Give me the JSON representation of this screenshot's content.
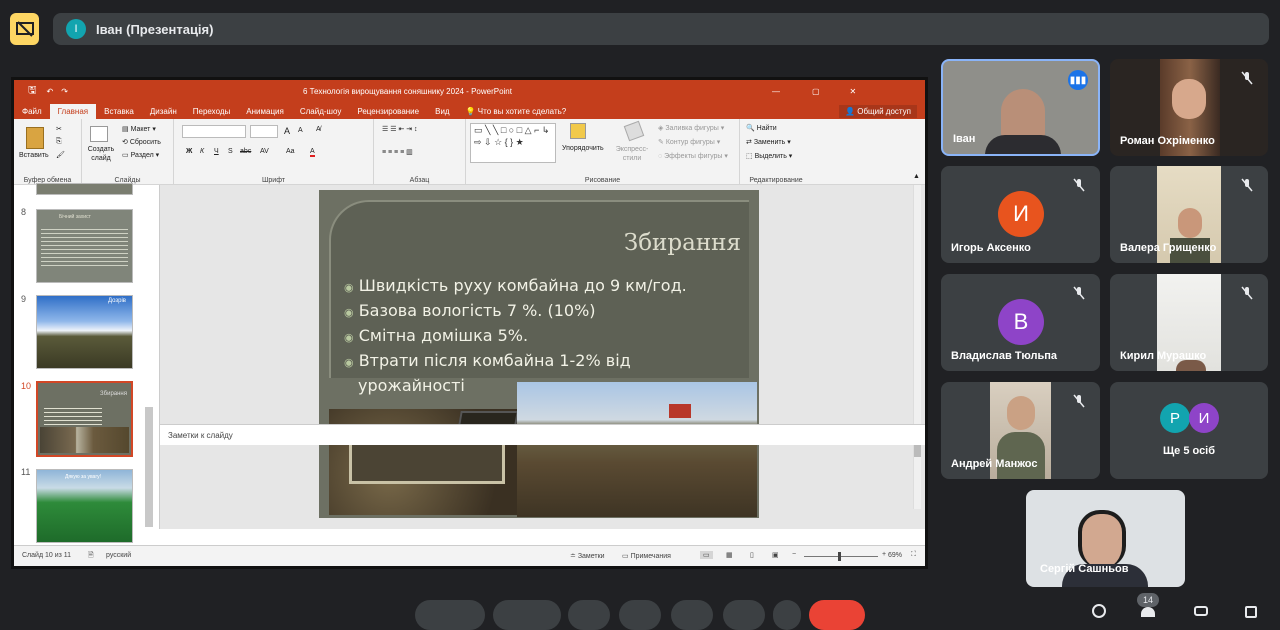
{
  "meet": {
    "presenter_avatar_letter": "І",
    "presenter_title": "Іван (Презентація)",
    "accent": "#fdd663",
    "more_count": "14"
  },
  "ppt": {
    "window_title": "6 Технологія вирощування соняшнику 2024 - PowerPoint",
    "tabs": [
      "Файл",
      "Главная",
      "Вставка",
      "Дизайн",
      "Переходы",
      "Анимация",
      "Слайд-шоу",
      "Рецензирование",
      "Вид",
      "Что вы хотите сделать?"
    ],
    "share_button": "Общий доступ",
    "ribbon": {
      "paste": "Вставить",
      "clipboard": "Буфер обмена",
      "new_slide": "Создать слайд",
      "layout": "Макет",
      "reset": "Сбросить",
      "section": "Раздел",
      "slides": "Слайды",
      "font": "Шрифт",
      "font_size_up": "A",
      "font_size_down": "A",
      "bold": "Ж",
      "italic": "К",
      "underline": "Ч",
      "strike": "S",
      "shadow": "abc",
      "spacing": "AV",
      "case": "Aa",
      "color": "A",
      "paragraph": "Абзац",
      "arrange": "Упорядочить",
      "quick_styles": "Экспресс-стили",
      "shape_fill": "Заливка фигуры",
      "shape_outline": "Контур фигуры",
      "shape_effects": "Эффекты фигуры",
      "drawing": "Рисование",
      "find": "Найти",
      "replace": "Заменить",
      "select": "Выделить",
      "editing": "Редактирование"
    },
    "thumb_numbers": [
      "8",
      "9",
      "10",
      "11"
    ],
    "thumb8_title": "Бічний захист",
    "thumb9_label": "Дозрів",
    "thumb10_title": "Збирання",
    "thumb11_title": "Дякую за увагу!",
    "slide": {
      "title": "Збирання",
      "bullets": [
        "Швидкість руху комбайна до 9 км/год.",
        "Базова вологість 7 %. (10%)",
        "Смітна домішка   5%.",
        "Втрати після комбайна 1-2% від урожайності"
      ]
    },
    "notes_placeholder": "Заметки к слайду",
    "status": {
      "slide_info": "Слайд 10 из 11",
      "language": "русский",
      "notes": "Заметки",
      "comments": "Примечания",
      "zoom": "69%"
    }
  },
  "participants": [
    {
      "name": "Іван",
      "type": "video",
      "speaking": true
    },
    {
      "name": "Роман Охріменко",
      "type": "video"
    },
    {
      "name": "Игорь Аксенко",
      "type": "avatar",
      "letter": "И",
      "color": "#e8541e"
    },
    {
      "name": "Валера Грищенко",
      "type": "video"
    },
    {
      "name": "Владислав Тюльпа",
      "type": "avatar",
      "letter": "В",
      "color": "#8e44c8"
    },
    {
      "name": "Кирил Мурашко",
      "type": "video"
    },
    {
      "name": "Андрей Манжос",
      "type": "video"
    },
    {
      "name": "Ще 5 осіб",
      "type": "more",
      "letters": [
        "Р",
        "И"
      ],
      "colors": [
        "#12a4af",
        "#8e44c8"
      ]
    }
  ],
  "self": {
    "name": "Сергій Сашньов"
  }
}
